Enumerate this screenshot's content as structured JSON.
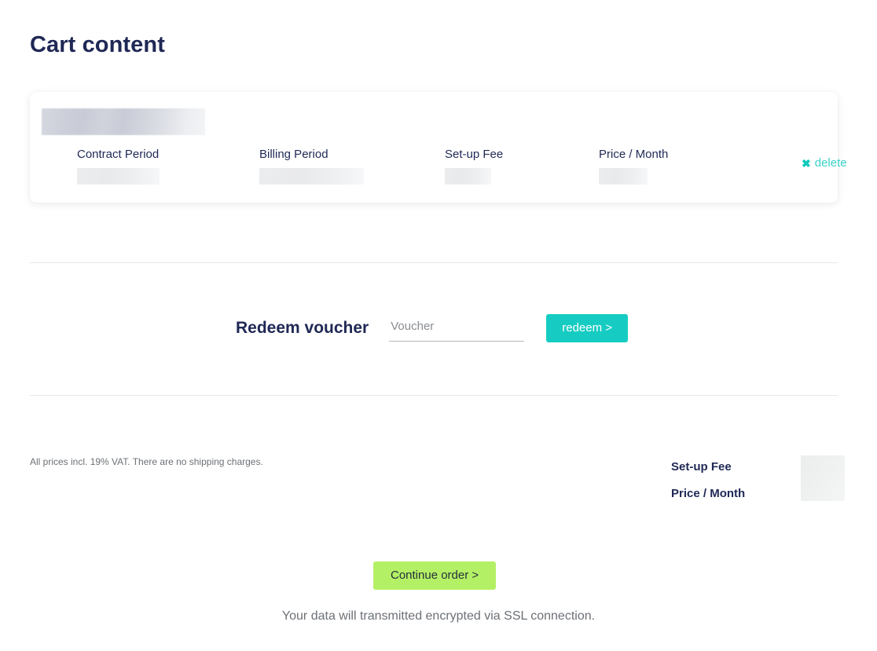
{
  "page": {
    "title": "Cart content"
  },
  "cart": {
    "product_name_redacted": true,
    "columns": [
      {
        "label": "Contract Period",
        "value_redacted": true
      },
      {
        "label": "Billing Period",
        "value_redacted": true
      },
      {
        "label": "Set-up Fee",
        "value_redacted": true
      },
      {
        "label": "Price / Month",
        "value_redacted": true
      }
    ],
    "delete": {
      "icon": "close-x-icon",
      "icon_glyph": "✖",
      "label": "delete"
    }
  },
  "voucher": {
    "heading": "Redeem voucher",
    "input_value": "",
    "placeholder": "Voucher",
    "button_label": "redeem >"
  },
  "footer": {
    "vat_note": "All prices incl. 19% VAT. There are no shipping charges.",
    "totals": [
      {
        "label": "Set-up Fee",
        "value_redacted": true
      },
      {
        "label": "Price / Month",
        "value_redacted": true
      }
    ],
    "continue_label": "Continue order >",
    "ssl_note": "Your data will transmitted encrypted via SSL connection."
  },
  "colors": {
    "heading_navy": "#1f2855",
    "teal_accent": "#16ccc2",
    "delete_teal": "#35cfc6",
    "lime_button": "#b4f065",
    "muted_text": "#6c7075",
    "divider": "#e8e8e8"
  }
}
